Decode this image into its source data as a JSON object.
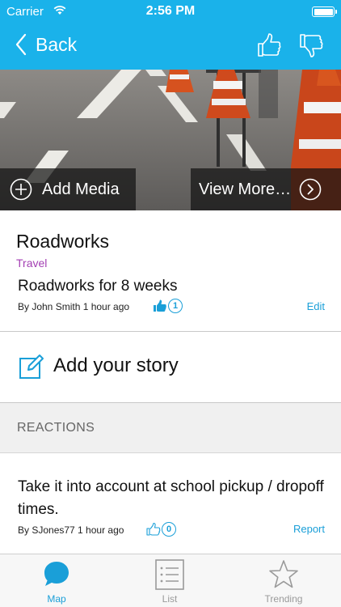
{
  "colors": {
    "header_bg": "#1ab2ea",
    "accent": "#1a9fd8",
    "category": "#a33fb3"
  },
  "status_bar": {
    "carrier": "Carrier",
    "time": "2:56 PM",
    "icons": [
      "wifi-icon",
      "battery-icon"
    ]
  },
  "nav": {
    "back_label": "Back",
    "icons": [
      "chevron-left-icon",
      "thumbs-up-icon",
      "thumbs-down-icon"
    ]
  },
  "hero": {
    "add_media_label": "Add Media",
    "view_more_label": "View More…",
    "icons": [
      "plus-circle-icon",
      "chevron-right-circle-icon"
    ]
  },
  "story": {
    "title": "Roadworks",
    "category": "Travel",
    "description": "Roadworks for 8 weeks",
    "byline": "By John Smith 1 hour ago",
    "like_count": "1",
    "edit_label": "Edit"
  },
  "add_story": {
    "label": "Add your story",
    "icon": "compose-icon"
  },
  "reactions": {
    "header": "REACTIONS",
    "items": [
      {
        "text": "Take it into account at school pickup / dropoff times.",
        "byline": "By SJones77 1 hour ago",
        "like_count": "0",
        "report_label": "Report"
      }
    ]
  },
  "tabbar": {
    "tabs": [
      {
        "label": "Map",
        "icon": "map-bubble-icon",
        "active": true
      },
      {
        "label": "List",
        "icon": "list-icon",
        "active": false
      },
      {
        "label": "Trending",
        "icon": "star-icon",
        "active": false
      }
    ]
  }
}
